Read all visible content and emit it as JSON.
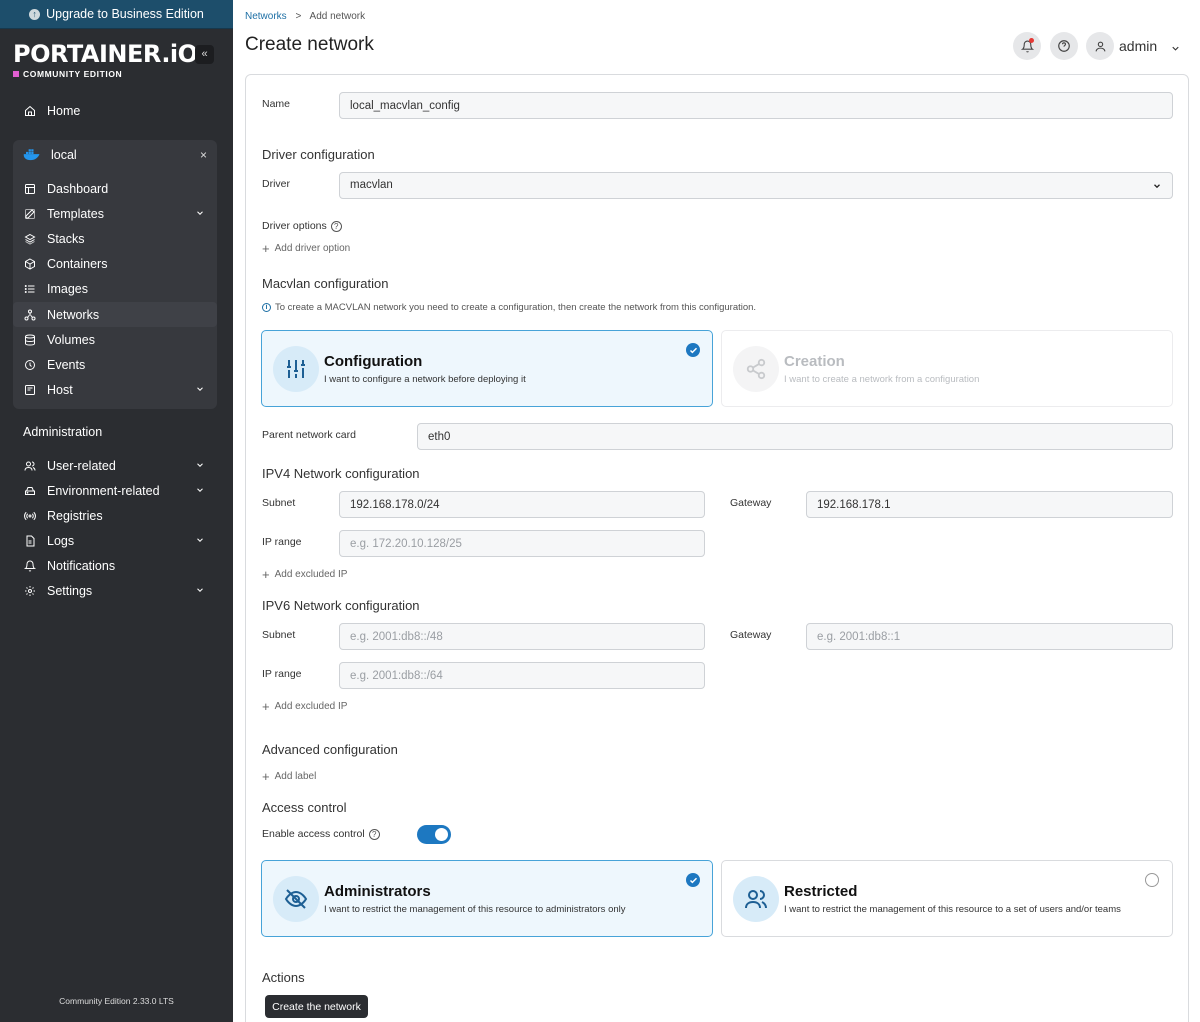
{
  "sidebar": {
    "upgrade_label": "Upgrade to Business Edition",
    "brand_name": "PORTAINER.iO",
    "brand_edition": "COMMUNITY EDITION",
    "collapse_label": "«",
    "home_label": "Home",
    "environment": {
      "name": "local",
      "close_label": "×",
      "items": [
        {
          "label": "Dashboard",
          "icon": "dashboard-icon"
        },
        {
          "label": "Templates",
          "icon": "templates-icon",
          "expandable": true
        },
        {
          "label": "Stacks",
          "icon": "stacks-icon"
        },
        {
          "label": "Containers",
          "icon": "containers-icon"
        },
        {
          "label": "Images",
          "icon": "images-icon"
        },
        {
          "label": "Networks",
          "icon": "networks-icon",
          "active": true
        },
        {
          "label": "Volumes",
          "icon": "volumes-icon"
        },
        {
          "label": "Events",
          "icon": "events-icon"
        },
        {
          "label": "Host",
          "icon": "host-icon",
          "expandable": true
        }
      ]
    },
    "admin_title": "Administration",
    "admin_items": [
      {
        "label": "User-related",
        "icon": "users-icon",
        "expandable": true
      },
      {
        "label": "Environment-related",
        "icon": "environment-icon",
        "expandable": true
      },
      {
        "label": "Registries",
        "icon": "registries-icon"
      },
      {
        "label": "Logs",
        "icon": "logs-icon",
        "expandable": true
      },
      {
        "label": "Notifications",
        "icon": "bell-icon"
      },
      {
        "label": "Settings",
        "icon": "gear-icon",
        "expandable": true
      }
    ],
    "footer_version": "Community Edition 2.33.0 LTS"
  },
  "header": {
    "breadcrumb_link": "Networks",
    "breadcrumb_sep": ">",
    "breadcrumb_current": "Add network",
    "title": "Create network",
    "user_name": "admin"
  },
  "form": {
    "name_label": "Name",
    "name_value": "local_macvlan_config",
    "driver_section": "Driver configuration",
    "driver_label": "Driver",
    "driver_value": "macvlan",
    "driver_options_label": "Driver options",
    "add_driver_option": "Add driver option",
    "macvlan_section": "Macvlan configuration",
    "macvlan_info": "To create a MACVLAN network you need to create a configuration, then create the network from this configuration.",
    "macvlan_options": [
      {
        "title": "Configuration",
        "desc": "I want to configure a network before deploying it",
        "selected": true
      },
      {
        "title": "Creation",
        "desc": "I want to create a network from a configuration",
        "selected": false
      }
    ],
    "parent_card_label": "Parent network card",
    "parent_card_value": "eth0",
    "ipv4_section": "IPV4 Network configuration",
    "ipv4": {
      "subnet_label": "Subnet",
      "subnet_value": "192.168.178.0/24",
      "gateway_label": "Gateway",
      "gateway_value": "192.168.178.1",
      "iprange_label": "IP range",
      "iprange_placeholder": "e.g. 172.20.10.128/25",
      "add_excluded": "Add excluded IP"
    },
    "ipv6_section": "IPV6 Network configuration",
    "ipv6": {
      "subnet_label": "Subnet",
      "subnet_placeholder": "e.g. 2001:db8::/48",
      "gateway_label": "Gateway",
      "gateway_placeholder": "e.g. 2001:db8::1",
      "iprange_label": "IP range",
      "iprange_placeholder": "e.g. 2001:db8::/64",
      "add_excluded": "Add excluded IP"
    },
    "advanced_section": "Advanced configuration",
    "add_label": "Add label",
    "access_section": "Access control",
    "enable_access_label": "Enable access control",
    "access_enabled": true,
    "access_options": [
      {
        "title": "Administrators",
        "desc": "I want to restrict the management of this resource to administrators only",
        "selected": true
      },
      {
        "title": "Restricted",
        "desc": "I want to restrict the management of this resource to a set of users and/or teams",
        "selected": false
      }
    ],
    "actions_section": "Actions",
    "submit_label": "Create the network"
  },
  "colors": {
    "sidebar_bg": "#2b2d31",
    "upgrade_bg": "#1d4e6b",
    "accent": "#1d78c1",
    "selected_card_bg": "#eef7fd",
    "brand_square": "#e15fd1"
  }
}
